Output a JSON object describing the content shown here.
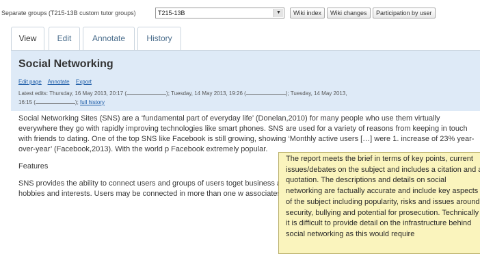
{
  "topbar": {
    "groups_label": "Separate groups (T215-13B custom tutor groups)",
    "group_selected": "T215-13B",
    "wiki_index_label": "Wiki index",
    "wiki_changes_label": "Wiki changes",
    "participation_label": "Participation by user"
  },
  "tabs": [
    {
      "label": "View",
      "active": true
    },
    {
      "label": "Edit",
      "active": false
    },
    {
      "label": "Annotate",
      "active": false
    },
    {
      "label": "History",
      "active": false
    }
  ],
  "page": {
    "title": "Social Networking",
    "actions": [
      "Edit page",
      "Annotate",
      "Export"
    ],
    "latest_edits_prefix": "Latest edits: Thursday, 16 May 2013, 20:17 (",
    "latest_edits_mid1": "); Tuesday, 14 May 2013, 19:26 (",
    "latest_edits_mid2": "); Tuesday, 14 May 2013,",
    "latest_edits_line2": "16:15 (",
    "latest_edits_end": ");",
    "full_history_label": "full history"
  },
  "content": {
    "paragraph1": "Social Networking Sites (SNS) are a ‘fundamental part of everyday life’ (Donelan,2010) for many people who use them virtually everywhere they go with rapidly improving technologies like smart phones. SNS are used for a variety of reasons from keeping in touch with friends to dating. One of the top SNS like Facebook is still growing, showing ‘Monthly active users […] were 1. increase of 23% year-over-year’ (Facebook,2013). With the world p Facebook extremely popular.",
    "features_heading": "Features",
    "paragraph2": "SNS provides the ability to connect users and groups of users toget business associates, potential employers using SNS like LinkedIn or hobbies and interests. Users may be connected in more than one w associates on LinkedIn, the relationship on both of these SNS are li"
  },
  "tooltip": {
    "text": "The report meets the brief in terms of key points, current issues/debates on the subject and includes a citation and a quotation. The descriptions and details on social networking are factually accurate and include key aspects of the subject including popularity, risks and issues around security, bullying and potential for prosecution. Technically it is difficult to provide detail on the infrastructure behind social networking as this would require"
  }
}
